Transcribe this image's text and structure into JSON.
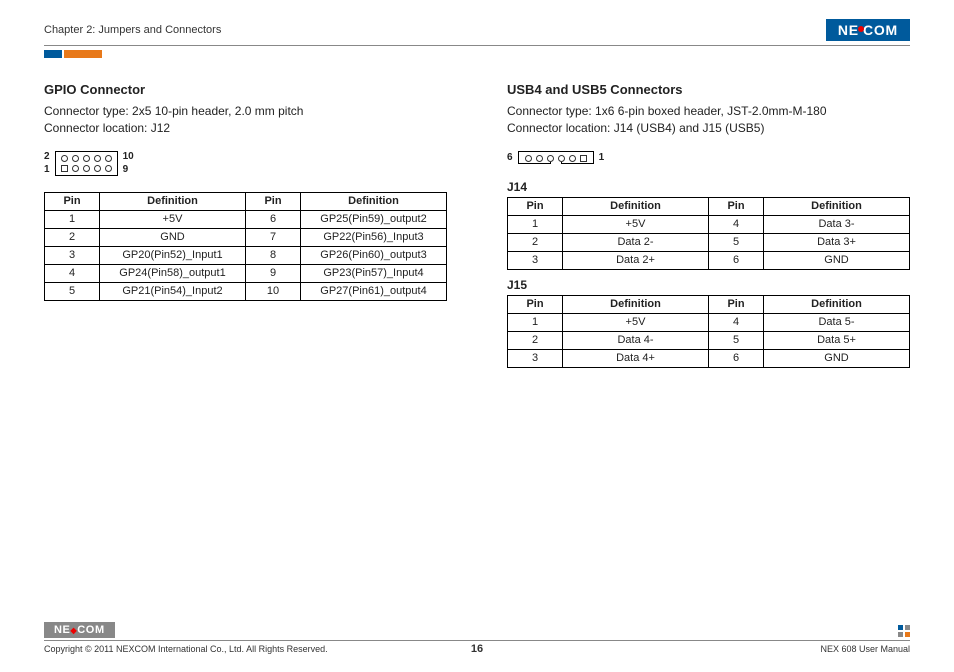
{
  "header": {
    "chapter": "Chapter 2: Jumpers and Connectors",
    "logo": "NEXCOM"
  },
  "left": {
    "title": "GPIO Connector",
    "desc1": "Connector type: 2x5 10-pin header, 2.0 mm pitch",
    "desc2": "Connector location: J12",
    "diag": {
      "tl": "2",
      "tr": "10",
      "bl": "1",
      "br": "9"
    },
    "th": {
      "pin": "Pin",
      "def": "Definition"
    },
    "rows": [
      {
        "p1": "1",
        "d1": "+5V",
        "p2": "6",
        "d2": "GP25(Pin59)_output2"
      },
      {
        "p1": "2",
        "d1": "GND",
        "p2": "7",
        "d2": "GP22(Pin56)_Input3"
      },
      {
        "p1": "3",
        "d1": "GP20(Pin52)_Input1",
        "p2": "8",
        "d2": "GP26(Pin60)_output3"
      },
      {
        "p1": "4",
        "d1": "GP24(Pin58)_output1",
        "p2": "9",
        "d2": "GP23(Pin57)_Input4"
      },
      {
        "p1": "5",
        "d1": "GP21(Pin54)_Input2",
        "p2": "10",
        "d2": "GP27(Pin61)_output4"
      }
    ]
  },
  "right": {
    "title": "USB4 and USB5 Connectors",
    "desc1": "Connector type: 1x6 6-pin boxed header,   JST-2.0mm-M-180",
    "desc2": "Connector location: J14 (USB4) and J15 (USB5)",
    "diag": {
      "left": "6",
      "right": "1"
    },
    "th": {
      "pin": "Pin",
      "def": "Definition"
    },
    "j14_label": "J14",
    "j14_rows": [
      {
        "p1": "1",
        "d1": "+5V",
        "p2": "4",
        "d2": "Data 3-"
      },
      {
        "p1": "2",
        "d1": "Data 2-",
        "p2": "5",
        "d2": "Data 3+"
      },
      {
        "p1": "3",
        "d1": "Data 2+",
        "p2": "6",
        "d2": "GND"
      }
    ],
    "j15_label": "J15",
    "j15_rows": [
      {
        "p1": "1",
        "d1": "+5V",
        "p2": "4",
        "d2": "Data 5-"
      },
      {
        "p1": "2",
        "d1": "Data 4-",
        "p2": "5",
        "d2": "Data 5+"
      },
      {
        "p1": "3",
        "d1": "Data 4+",
        "p2": "6",
        "d2": "GND"
      }
    ]
  },
  "footer": {
    "logo": "NEXCOM",
    "copyright": "Copyright © 2011 NEXCOM International Co., Ltd. All Rights Reserved.",
    "page": "16",
    "manual": "NEX 608 User Manual"
  }
}
